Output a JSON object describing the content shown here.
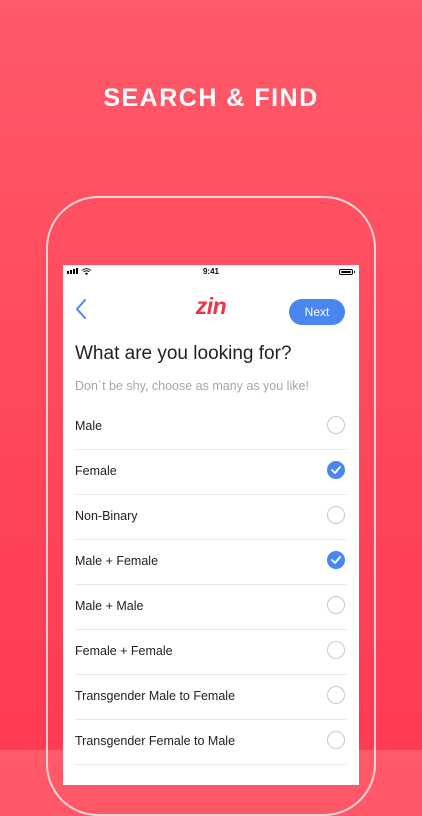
{
  "headline": "SEARCH & FIND",
  "status_bar": {
    "time": "9:41"
  },
  "nav": {
    "logo": "zin",
    "next_label": "Next"
  },
  "question": "What are you looking for?",
  "hint": "Don`t be shy, choose as many as you like!",
  "options": [
    {
      "label": "Male",
      "checked": false
    },
    {
      "label": "Female",
      "checked": true
    },
    {
      "label": "Non-Binary",
      "checked": false
    },
    {
      "label": "Male + Female",
      "checked": true
    },
    {
      "label": "Male + Male",
      "checked": false
    },
    {
      "label": "Female + Female",
      "checked": false
    },
    {
      "label": "Transgender Male to Female",
      "checked": false
    },
    {
      "label": "Transgender Female to Male",
      "checked": false
    }
  ],
  "colors": {
    "accent": "#4a86f0",
    "brand": "#f0334a",
    "background": "#ff4a5c"
  },
  "icons": {
    "back": "chevron-left-icon",
    "check": "checkmark-icon"
  }
}
